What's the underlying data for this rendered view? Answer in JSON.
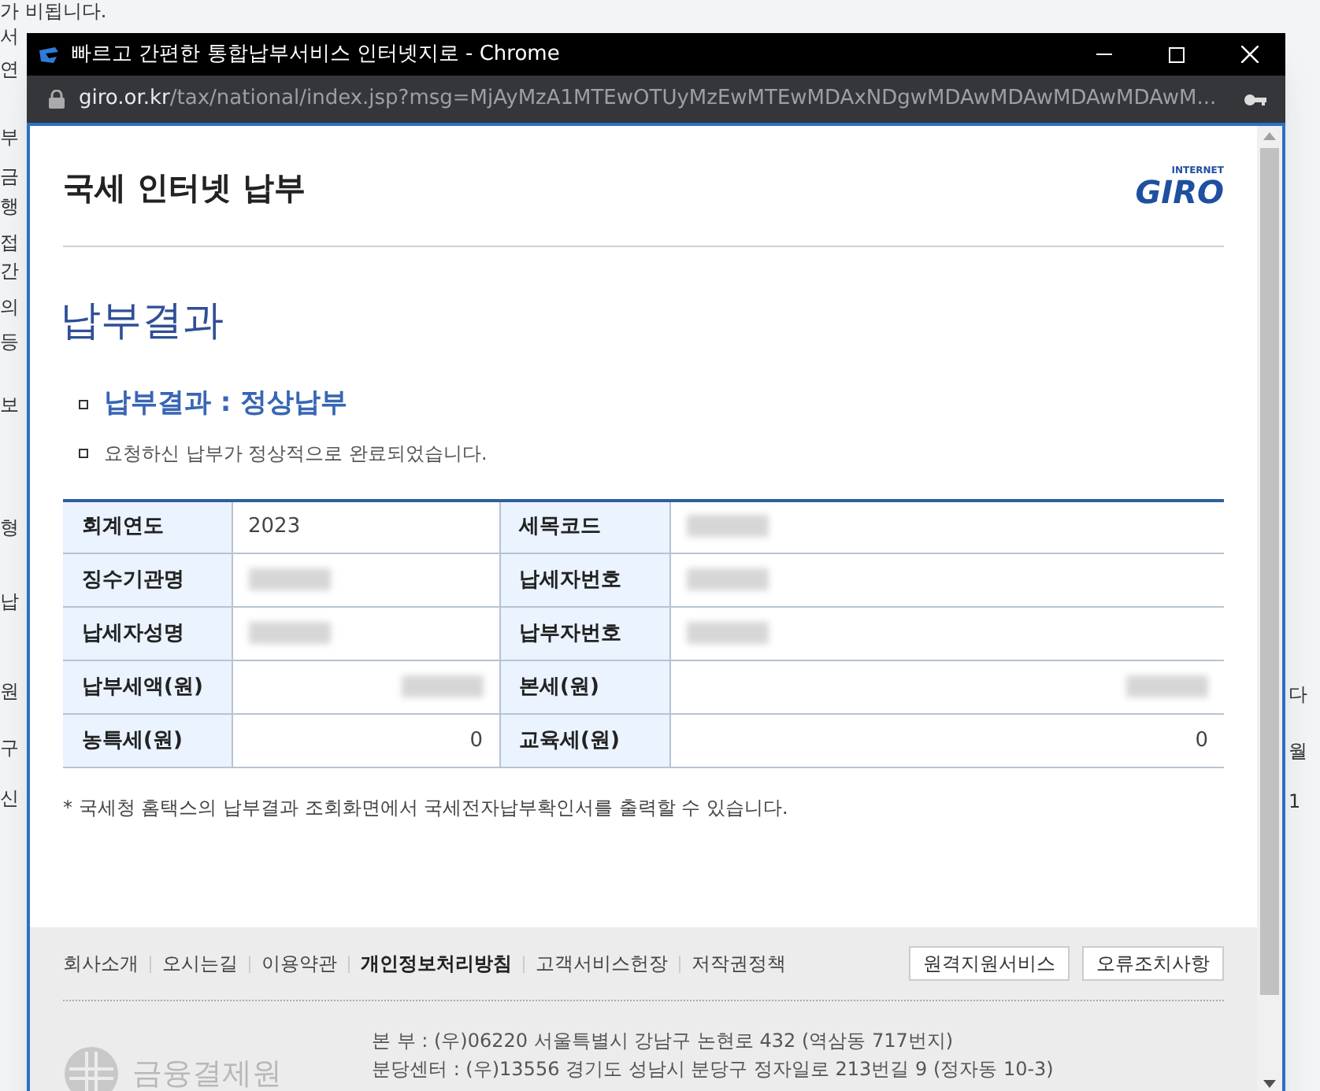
{
  "background_page": {
    "left_fragments": [
      "가 비됩니다.",
      "서",
      "연",
      "부",
      "금",
      "행",
      "접",
      "간",
      "의",
      "등",
      "보",
      "형",
      "납",
      "원",
      "구",
      "신"
    ],
    "right_fragments": [
      "다",
      "월",
      "1"
    ]
  },
  "window": {
    "title": "빠르고 간편한 통합납부서비스 인터넷지로 - Chrome",
    "url_host": "giro.or.kr",
    "url_path": "/tax/national/index.jsp?msg=MjAyMzA1MTEwOTUyMzEwMTEwMDAxNDgwMDAwMDAwMDAwMDAwM..."
  },
  "header": {
    "title": "국세 인터넷 납부",
    "logo_small": "INTERNET",
    "logo": "GIRO"
  },
  "page_title": "납부결과",
  "result_heading": "납부결과 : 정상납부",
  "result_message": "요청하신 납부가 정상적으로 완료되었습니다.",
  "table": {
    "rows": [
      [
        {
          "label": "회계연도",
          "value": "2023",
          "redacted": false,
          "kind": "text"
        },
        {
          "label": "세목코드",
          "redacted": true,
          "kind": "text"
        }
      ],
      [
        {
          "label": "징수기관명",
          "redacted": true,
          "kind": "text"
        },
        {
          "label": "납세자번호",
          "redacted": true,
          "kind": "text"
        }
      ],
      [
        {
          "label": "납세자성명",
          "redacted": true,
          "kind": "text"
        },
        {
          "label": "납부자번호",
          "redacted": true,
          "kind": "text"
        }
      ],
      [
        {
          "label": "납부세액(원)",
          "redacted": true,
          "kind": "amount"
        },
        {
          "label": "본세(원)",
          "redacted": true,
          "kind": "amount"
        }
      ],
      [
        {
          "label": "농특세(원)",
          "value": "0",
          "redacted": false,
          "kind": "amount"
        },
        {
          "label": "교육세(원)",
          "value": "0",
          "redacted": false,
          "kind": "amount"
        }
      ]
    ]
  },
  "note": "* 국세청 홈택스의 납부결과 조회화면에서 국세전자납부확인서를 출력할 수 있습니다.",
  "footer": {
    "links": [
      {
        "label": "회사소개",
        "bold": false
      },
      {
        "label": "오시는길",
        "bold": false
      },
      {
        "label": "이용약관",
        "bold": false
      },
      {
        "label": "개인정보처리방침",
        "bold": true
      },
      {
        "label": "고객서비스헌장",
        "bold": false
      },
      {
        "label": "저작권정책",
        "bold": false
      }
    ],
    "buttons": [
      "원격지원서비스",
      "오류조치사항"
    ],
    "address_lines": [
      "본 부 : (우)06220 서울특별시 강남구 논현로 432 (역삼동 717번지)",
      "분당센터 : (우)13556 경기도 성남시 분당구 정자일로 213번길 9 (정자동 10-3)"
    ],
    "org": "금융결제원"
  }
}
